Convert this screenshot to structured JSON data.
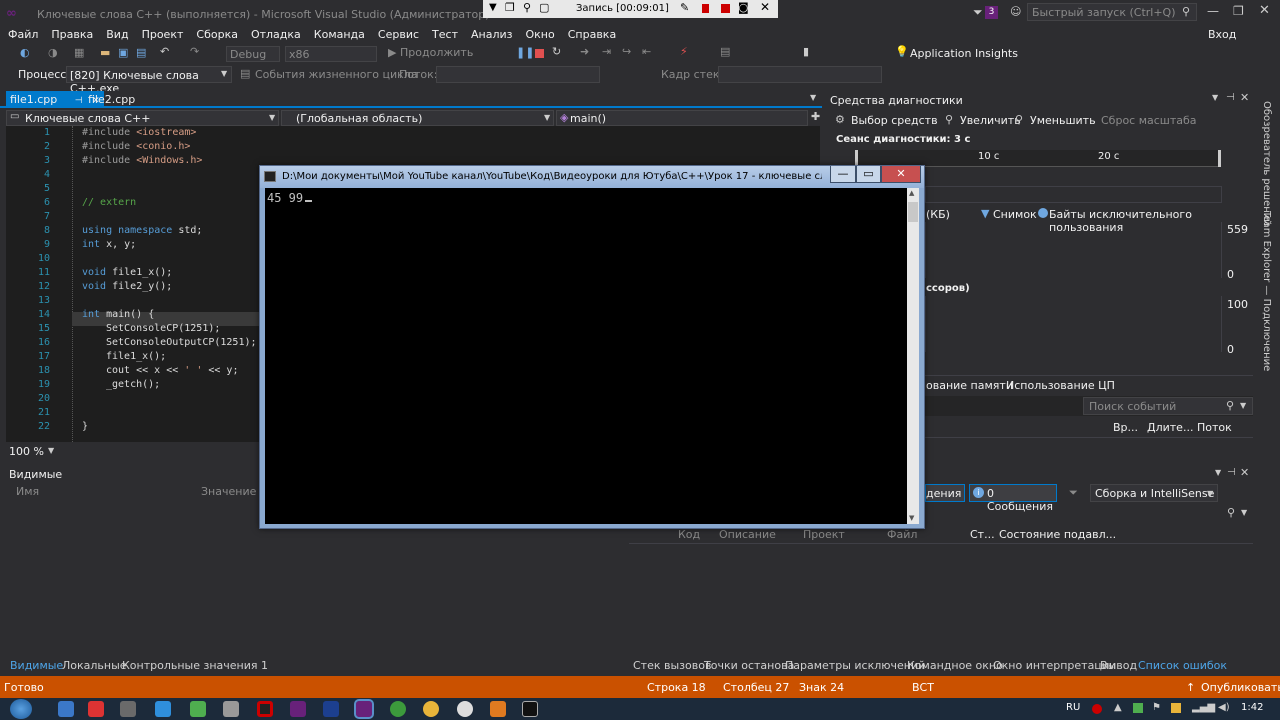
{
  "window": {
    "title": "Ключевые слова C++ (выполняется) - Microsoft Visual Studio (Администратор)",
    "recording": "Запись [00:09:01]",
    "notification_count": "3",
    "quick_launch_placeholder": "Быстрый запуск (Ctrl+Q)",
    "sign_in": "Вход"
  },
  "menu": [
    "Файл",
    "Правка",
    "Вид",
    "Проект",
    "Сборка",
    "Отладка",
    "Команда",
    "Сервис",
    "Тест",
    "Анализ",
    "Окно",
    "Справка"
  ],
  "toolbar": {
    "config": "Debug",
    "platform": "x86",
    "continue_label": "Продолжить",
    "app_insights": "Application Insights"
  },
  "process_bar": {
    "process_label": "Процесс:",
    "process_value": "[820] Ключевые слова C++.exe",
    "lifecycle_label": "События жизненного цикла",
    "thread_label": "Поток:",
    "stack_label": "Кадр стека:"
  },
  "editor": {
    "tabs": [
      {
        "label": "file1.cpp"
      },
      {
        "label": "file2.cpp"
      }
    ],
    "nav_project": "Ключевые слова C++",
    "nav_scope": "(Глобальная область)",
    "nav_member": "main()",
    "zoom": "100 %",
    "line_numbers": [
      "1",
      "2",
      "3",
      "4",
      "5",
      "6",
      "7",
      "8",
      "9",
      "10",
      "11",
      "12",
      "13",
      "14",
      "15",
      "16",
      "17",
      "18",
      "19",
      "20",
      "21",
      "22"
    ]
  },
  "console": {
    "title": "D:\\Мои документы\\Мой YouTube канал\\YouTube\\Код\\Видеоуроки для Ютуба\\С++\\Урок 17 - ключевые слова С++\\Кл...",
    "output": "45 99"
  },
  "diagnostics": {
    "title": "Средства диагностики",
    "tools_select": "Выбор средств",
    "zoom_in": "Увеличить",
    "zoom_out": "Уменьшить",
    "reset_zoom": "Сброс масштаба",
    "session": "Сеанс диагностики: 3 с",
    "tick_10": "10 с",
    "tick_20": "20 с",
    "memory_unit": "(КБ)",
    "snapshot": "Снимок",
    "private_bytes": "Байты исключительного пользования",
    "mem_max": "559",
    "mem_min": "0",
    "cpu_label": "ссоров)",
    "cpu_max": "100",
    "cpu_min": "0",
    "tab_memory": "ование памяти",
    "tab_cpu": "Использование ЦП",
    "search_placeholder": "Поиск событий",
    "col_time": "Вр...",
    "col_duration": "Длите...",
    "col_thread": "Поток"
  },
  "error_list": {
    "warnings": "дения",
    "messages": "0 Сообщения",
    "filter": "Сборка и IntelliSense",
    "col_code": "Код",
    "col_desc": "Описание",
    "col_project": "Проект",
    "col_file": "Файл",
    "col_line": "Ст...",
    "col_state": "Состояние подавл..."
  },
  "locals": {
    "title": "Видимые",
    "col_name": "Имя",
    "col_value": "Значение"
  },
  "bottom_tabs_left": [
    "Видимые",
    "Локальные",
    "Контрольные значения 1"
  ],
  "bottom_tabs_right": [
    "Стек вызовов",
    "Точки останова",
    "Параметры исключений",
    "Командное окно",
    "Окно интерпретации",
    "Вывод",
    "Список ошибок"
  ],
  "status": {
    "ready": "Готово",
    "line": "Строка 18",
    "column": "Столбец 27",
    "char": "Знак 24",
    "mode": "ВСТ",
    "publish": "Опубликовать"
  },
  "right_sidebar": {
    "solution_explorer": "Обозреватель решений",
    "team_explorer": "Team Explorer — Подключение"
  },
  "taskbar": {
    "lang": "RU",
    "time": "1:42"
  },
  "colors": {
    "accent": "#007acc",
    "status": "#ca5100",
    "editor_bg": "#1e1e1e"
  }
}
